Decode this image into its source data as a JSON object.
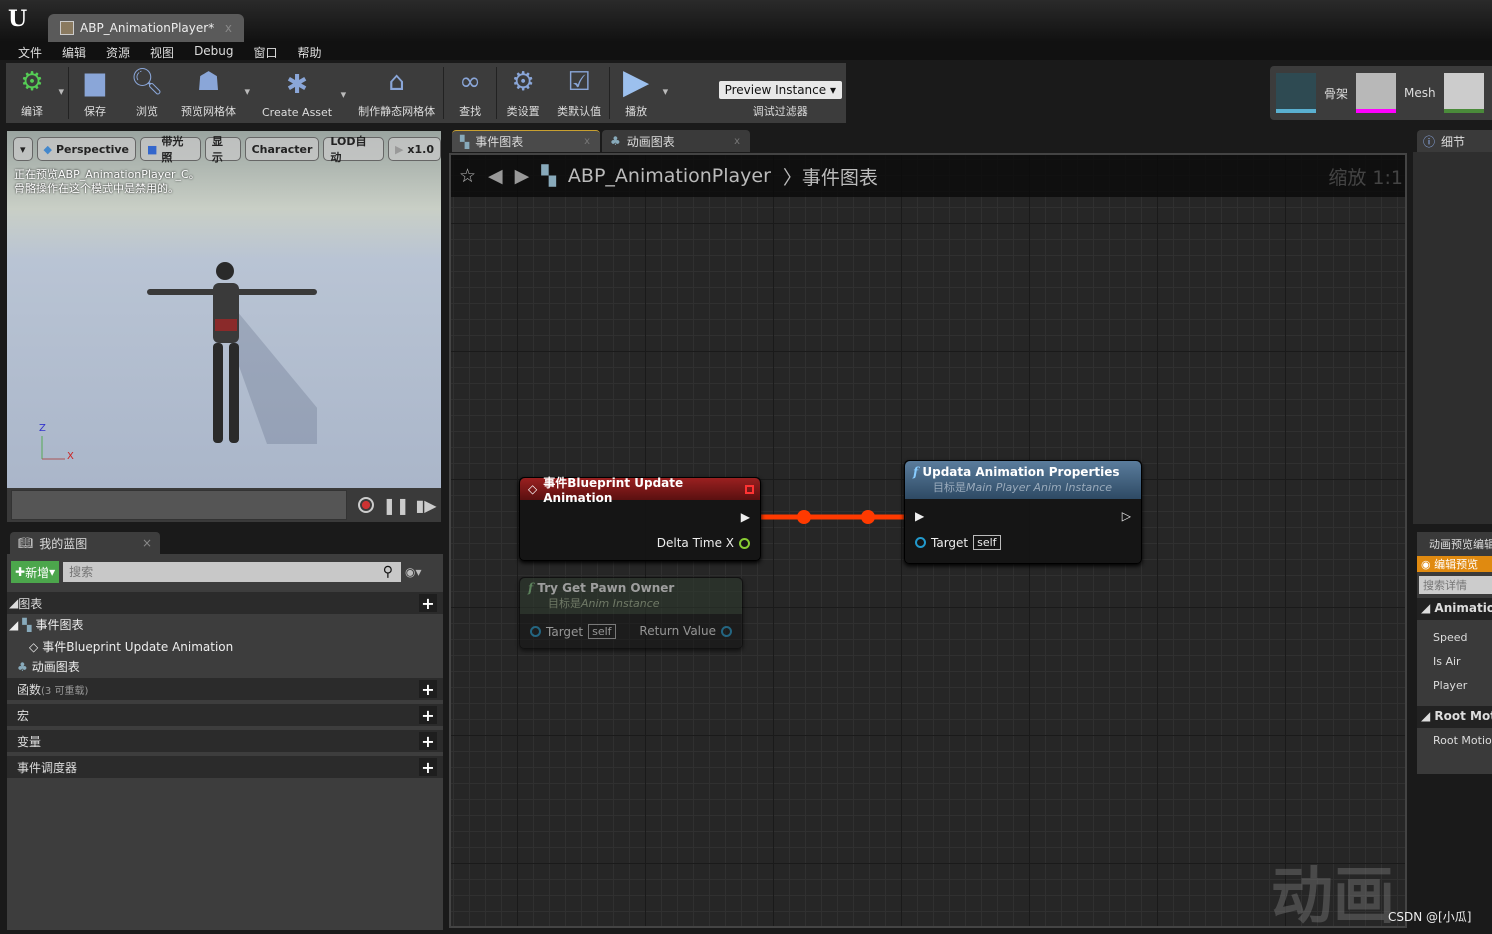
{
  "window": {
    "tab_title": "ABP_AnimationPlayer*",
    "close": "x"
  },
  "menu": [
    "文件",
    "编辑",
    "资源",
    "视图",
    "Debug",
    "窗口",
    "帮助"
  ],
  "toolbar": {
    "compile": "编译",
    "save": "保存",
    "browse": "浏览",
    "preview_mesh": "预览网格体",
    "create_asset": "Create Asset",
    "make_static_mesh": "制作静态网格体",
    "find": "查找",
    "class_settings": "类设置",
    "class_defaults": "类默认值",
    "play": "播放",
    "debug_filter_value": "Preview Instance",
    "debug_filter_label": "调试过滤器"
  },
  "asset_bar": {
    "skeleton": "骨架",
    "mesh": "Mesh",
    "colors": {
      "skeleton": "#5ab0d0",
      "mesh": "#ff00ff",
      "anim": "#4a8a3a"
    }
  },
  "viewport": {
    "buttons": [
      "Perspective",
      "带光照",
      "显示",
      "Character",
      "LOD自动",
      "x1.0"
    ],
    "info_line1": "正在预览ABP_AnimationPlayer_C。",
    "info_line2": "骨骼操作在这个模式中是禁用的。",
    "axis_z": "Z",
    "axis_x": "X"
  },
  "my_blueprint": {
    "tab": "我的蓝图",
    "add": "新增",
    "search_placeholder": "搜索",
    "sections": {
      "graphs": "图表",
      "event_graph": "事件图表",
      "event_node": "事件Blueprint Update Animation",
      "anim_graph": "动画图表",
      "functions": "函数",
      "functions_note": "(3 可重载)",
      "macros": "宏",
      "variables": "变量",
      "dispatchers": "事件调度器"
    }
  },
  "graph_tabs": [
    {
      "label": "事件图表"
    },
    {
      "label": "动画图表"
    }
  ],
  "graph": {
    "breadcrumb_root": "ABP_AnimationPlayer",
    "breadcrumb_sep": "〉",
    "breadcrumb_current": "事件图表",
    "zoom": "缩放 1:1",
    "watermark": "动画",
    "nodes": {
      "event": {
        "title": "事件Blueprint Update Animation",
        "pin_out": "Delta Time X",
        "color": "#8a1a1a"
      },
      "update": {
        "title": "Updata Animation Properties",
        "subtitle_prefix": "目标是",
        "subtitle_target": "Main Player Anim Instance",
        "pin": "Target",
        "self": "self",
        "color": "#4a6a8a"
      },
      "pawn": {
        "title": "Try Get Pawn Owner",
        "subtitle_prefix": "目标是",
        "subtitle_target": "Anim Instance",
        "pin": "Target",
        "self": "self",
        "return": "Return Value"
      }
    },
    "wire_color": "#ff3a00"
  },
  "details": {
    "tab": "细节",
    "anim_preview_tab": "动画预览编辑器",
    "edit_preview": "编辑预览",
    "search_placeholder": "搜索详情",
    "animation_section": "Animation",
    "props": [
      "Speed",
      "Is Air",
      "Player"
    ],
    "root_motion_section": "Root Motion",
    "root_motion_prop": "Root Motion"
  },
  "credit": "CSDN @[小瓜]"
}
